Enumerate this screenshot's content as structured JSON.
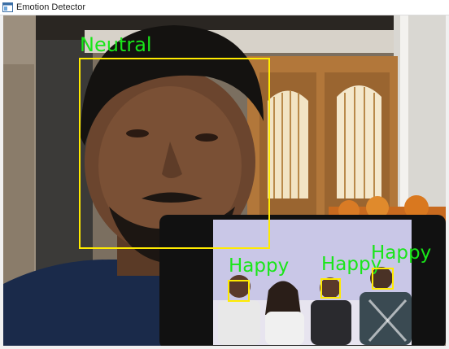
{
  "window": {
    "title": "Emotion Detector"
  },
  "detections": [
    {
      "id": "main",
      "label": "Neutral"
    },
    {
      "id": "p1",
      "label": "Happy"
    },
    {
      "id": "p2",
      "label": "Happy"
    },
    {
      "id": "p3",
      "label": "Happy"
    }
  ],
  "colors": {
    "box": "#ffeb00",
    "label": "#19e619"
  }
}
